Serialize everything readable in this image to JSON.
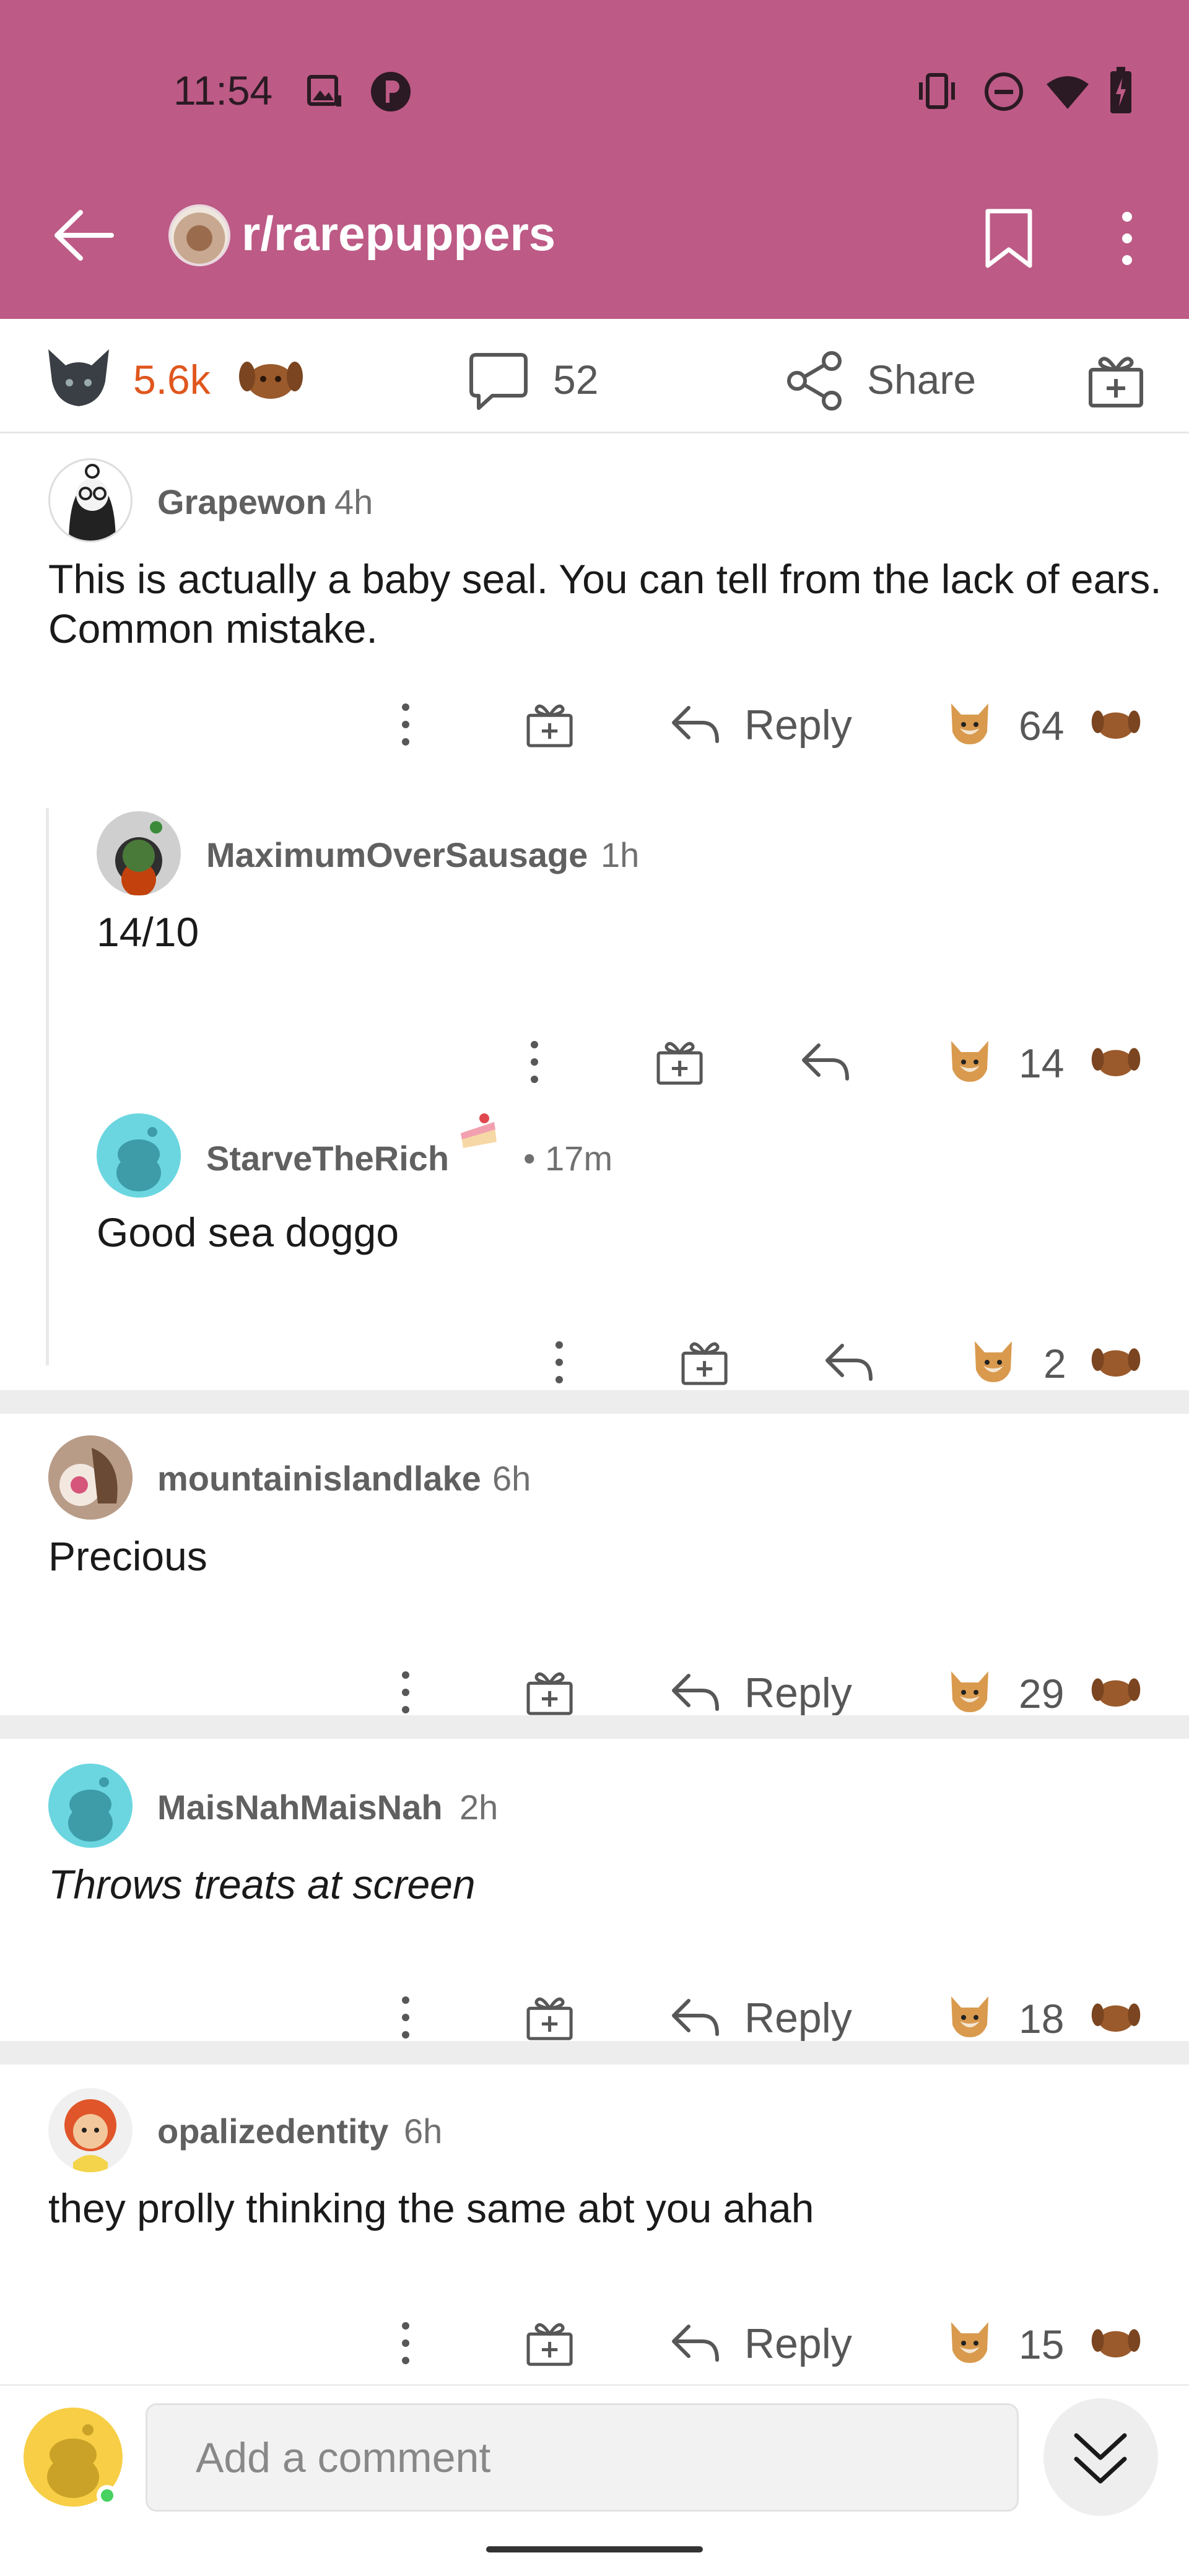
{
  "status_bar": {
    "time": "11:54"
  },
  "header": {
    "subreddit": "r/rarepuppers"
  },
  "action_bar": {
    "score": "5.6k",
    "comments": "52",
    "share_label": "Share"
  },
  "reply_label": "Reply",
  "comments": [
    {
      "author": "Grapewon",
      "time": "4h",
      "body": "This is actually a baby seal. You can tell from the lack of ears. Common mistake.",
      "score": "64"
    },
    {
      "author": "MaximumOverSausage",
      "time": "1h",
      "body": "14/10",
      "score": "14"
    },
    {
      "author": "StarveTheRich",
      "time": "• 17m",
      "body": "Good sea doggo",
      "score": "2"
    },
    {
      "author": "mountainislandlake",
      "time": "6h",
      "body": "Precious",
      "score": "29"
    },
    {
      "author": "MaisNahMaisNah",
      "time": "2h",
      "body": "Throws treats at screen",
      "score": "18"
    },
    {
      "author": "opalizedentity",
      "time": "6h",
      "body": "they prolly thinking the same abt you ahah",
      "score": "15"
    }
  ],
  "composer": {
    "placeholder": "Add a comment"
  },
  "colors": {
    "header_bg": "#bd5a86",
    "upvote_score": "#e0561d",
    "online": "#46d160"
  },
  "icons": [
    "back-arrow-icon",
    "bookmark-icon",
    "more-vertical-icon",
    "upvote-icon",
    "downvote-icon",
    "comment-icon",
    "share-icon",
    "award-icon",
    "reply-icon"
  ]
}
